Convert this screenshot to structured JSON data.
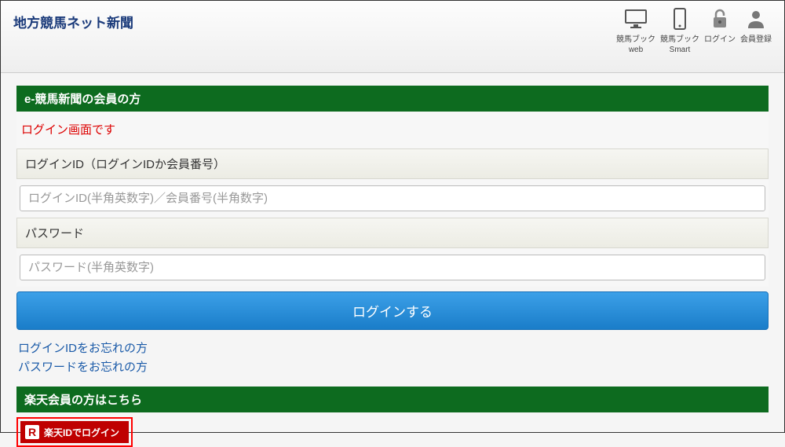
{
  "header": {
    "site_title": "地方競馬ネット新聞",
    "nav": [
      {
        "label1": "競馬ブック",
        "label2": "web"
      },
      {
        "label1": "競馬ブック",
        "label2": "Smart"
      },
      {
        "label1": "ログイン",
        "label2": ""
      },
      {
        "label1": "会員登録",
        "label2": ""
      }
    ]
  },
  "login": {
    "section_title": "e-競馬新聞の会員の方",
    "notice": "ログイン画面です",
    "id_label": "ログインID（ログインIDか会員番号）",
    "id_placeholder": "ログインID(半角英数字)／会員番号(半角数字)",
    "pw_label": "パスワード",
    "pw_placeholder": "パスワード(半角英数字)",
    "submit_label": "ログインする",
    "forgot_id": "ログインIDをお忘れの方",
    "forgot_pw": "パスワードをお忘れの方"
  },
  "rakuten": {
    "section_title": "楽天会員の方はこちら",
    "r_logo": "R",
    "btn_label": "楽天IDでログイン"
  }
}
